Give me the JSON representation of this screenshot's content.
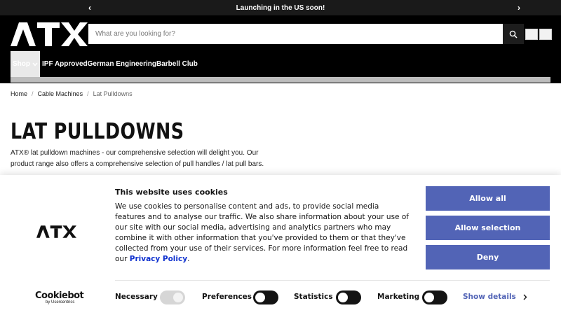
{
  "announcement": {
    "text": "Launching in the US soon!"
  },
  "header": {
    "logo_text": "ATX",
    "search_placeholder": "What are you looking for?",
    "nav": {
      "shop_label": "Shop",
      "items": [
        "IPF Approved",
        "German Engineering",
        "Barbell Club"
      ]
    }
  },
  "breadcrumb": {
    "items": [
      "Home",
      "Cable Machines",
      "Lat Pulldowns"
    ],
    "separator": "/"
  },
  "page": {
    "title": "LAT PULLDOWNS",
    "description": "ATX® lat pulldown machines - our comprehensive selection will delight you. Our product range also offers a comprehensive selection of pull handles / lat pull bars."
  },
  "cookie_banner": {
    "logo_text": "ATX",
    "title": "This website uses cookies",
    "body": "We use cookies to personalise content and ads, to provide social media features and to analyse our traffic. We also share information about your use of our site with our social media, advertising and analytics partners who may combine it with other information that you've provided to them or that they've collected from your use of their services. For more information feel free to read our",
    "privacy_link": "Privacy Policy",
    "body_end": ".",
    "buttons": {
      "allow_all": "Allow all",
      "allow_selection": "Allow selection",
      "deny": "Deny"
    },
    "brand": {
      "name": "Cookiebot",
      "by": "by Usercentrics"
    },
    "toggles": [
      {
        "label": "Necessary",
        "state": "on-disabled"
      },
      {
        "label": "Preferences",
        "state": "off"
      },
      {
        "label": "Statistics",
        "state": "off"
      },
      {
        "label": "Marketing",
        "state": "off"
      }
    ],
    "show_details": "Show details"
  },
  "colors": {
    "accent": "#5264b6",
    "link": "#1032cf",
    "header_bg": "#000000",
    "announce_bg": "#1a1a1a"
  }
}
